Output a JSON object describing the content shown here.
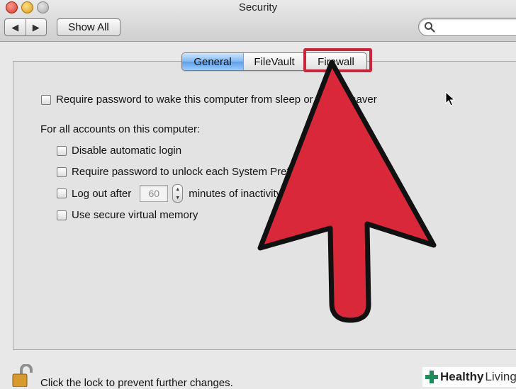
{
  "window": {
    "title": "Security"
  },
  "toolbar": {
    "back_glyph": "◀",
    "forward_glyph": "▶",
    "show_all_label": "Show All",
    "search_placeholder": ""
  },
  "tabs": [
    {
      "label": "General",
      "selected": true
    },
    {
      "label": "FileVault",
      "selected": false
    },
    {
      "label": "Firewall",
      "selected": false
    }
  ],
  "general": {
    "require_password_wake_label": "Require password to wake this computer from sleep or screen saver",
    "all_accounts_heading": "For all accounts on this computer:",
    "options": [
      {
        "label": "Disable automatic login",
        "checked": false
      },
      {
        "label": "Require password to unlock each System Preferences pane",
        "checked": false
      },
      {
        "label_before": "Log out after",
        "minutes_value": "60",
        "label_after": "minutes of inactivity",
        "checked": false
      },
      {
        "label": "Use secure virtual memory",
        "checked": false
      }
    ]
  },
  "footer": {
    "lock_text": "Click the lock to prevent further changes."
  },
  "overlay": {
    "highlight_color": "#c8263c",
    "arrow_color": "#d8283a",
    "target": "Firewall"
  },
  "watermark": {
    "part_bold": "Healthy",
    "part_light": "Living"
  }
}
